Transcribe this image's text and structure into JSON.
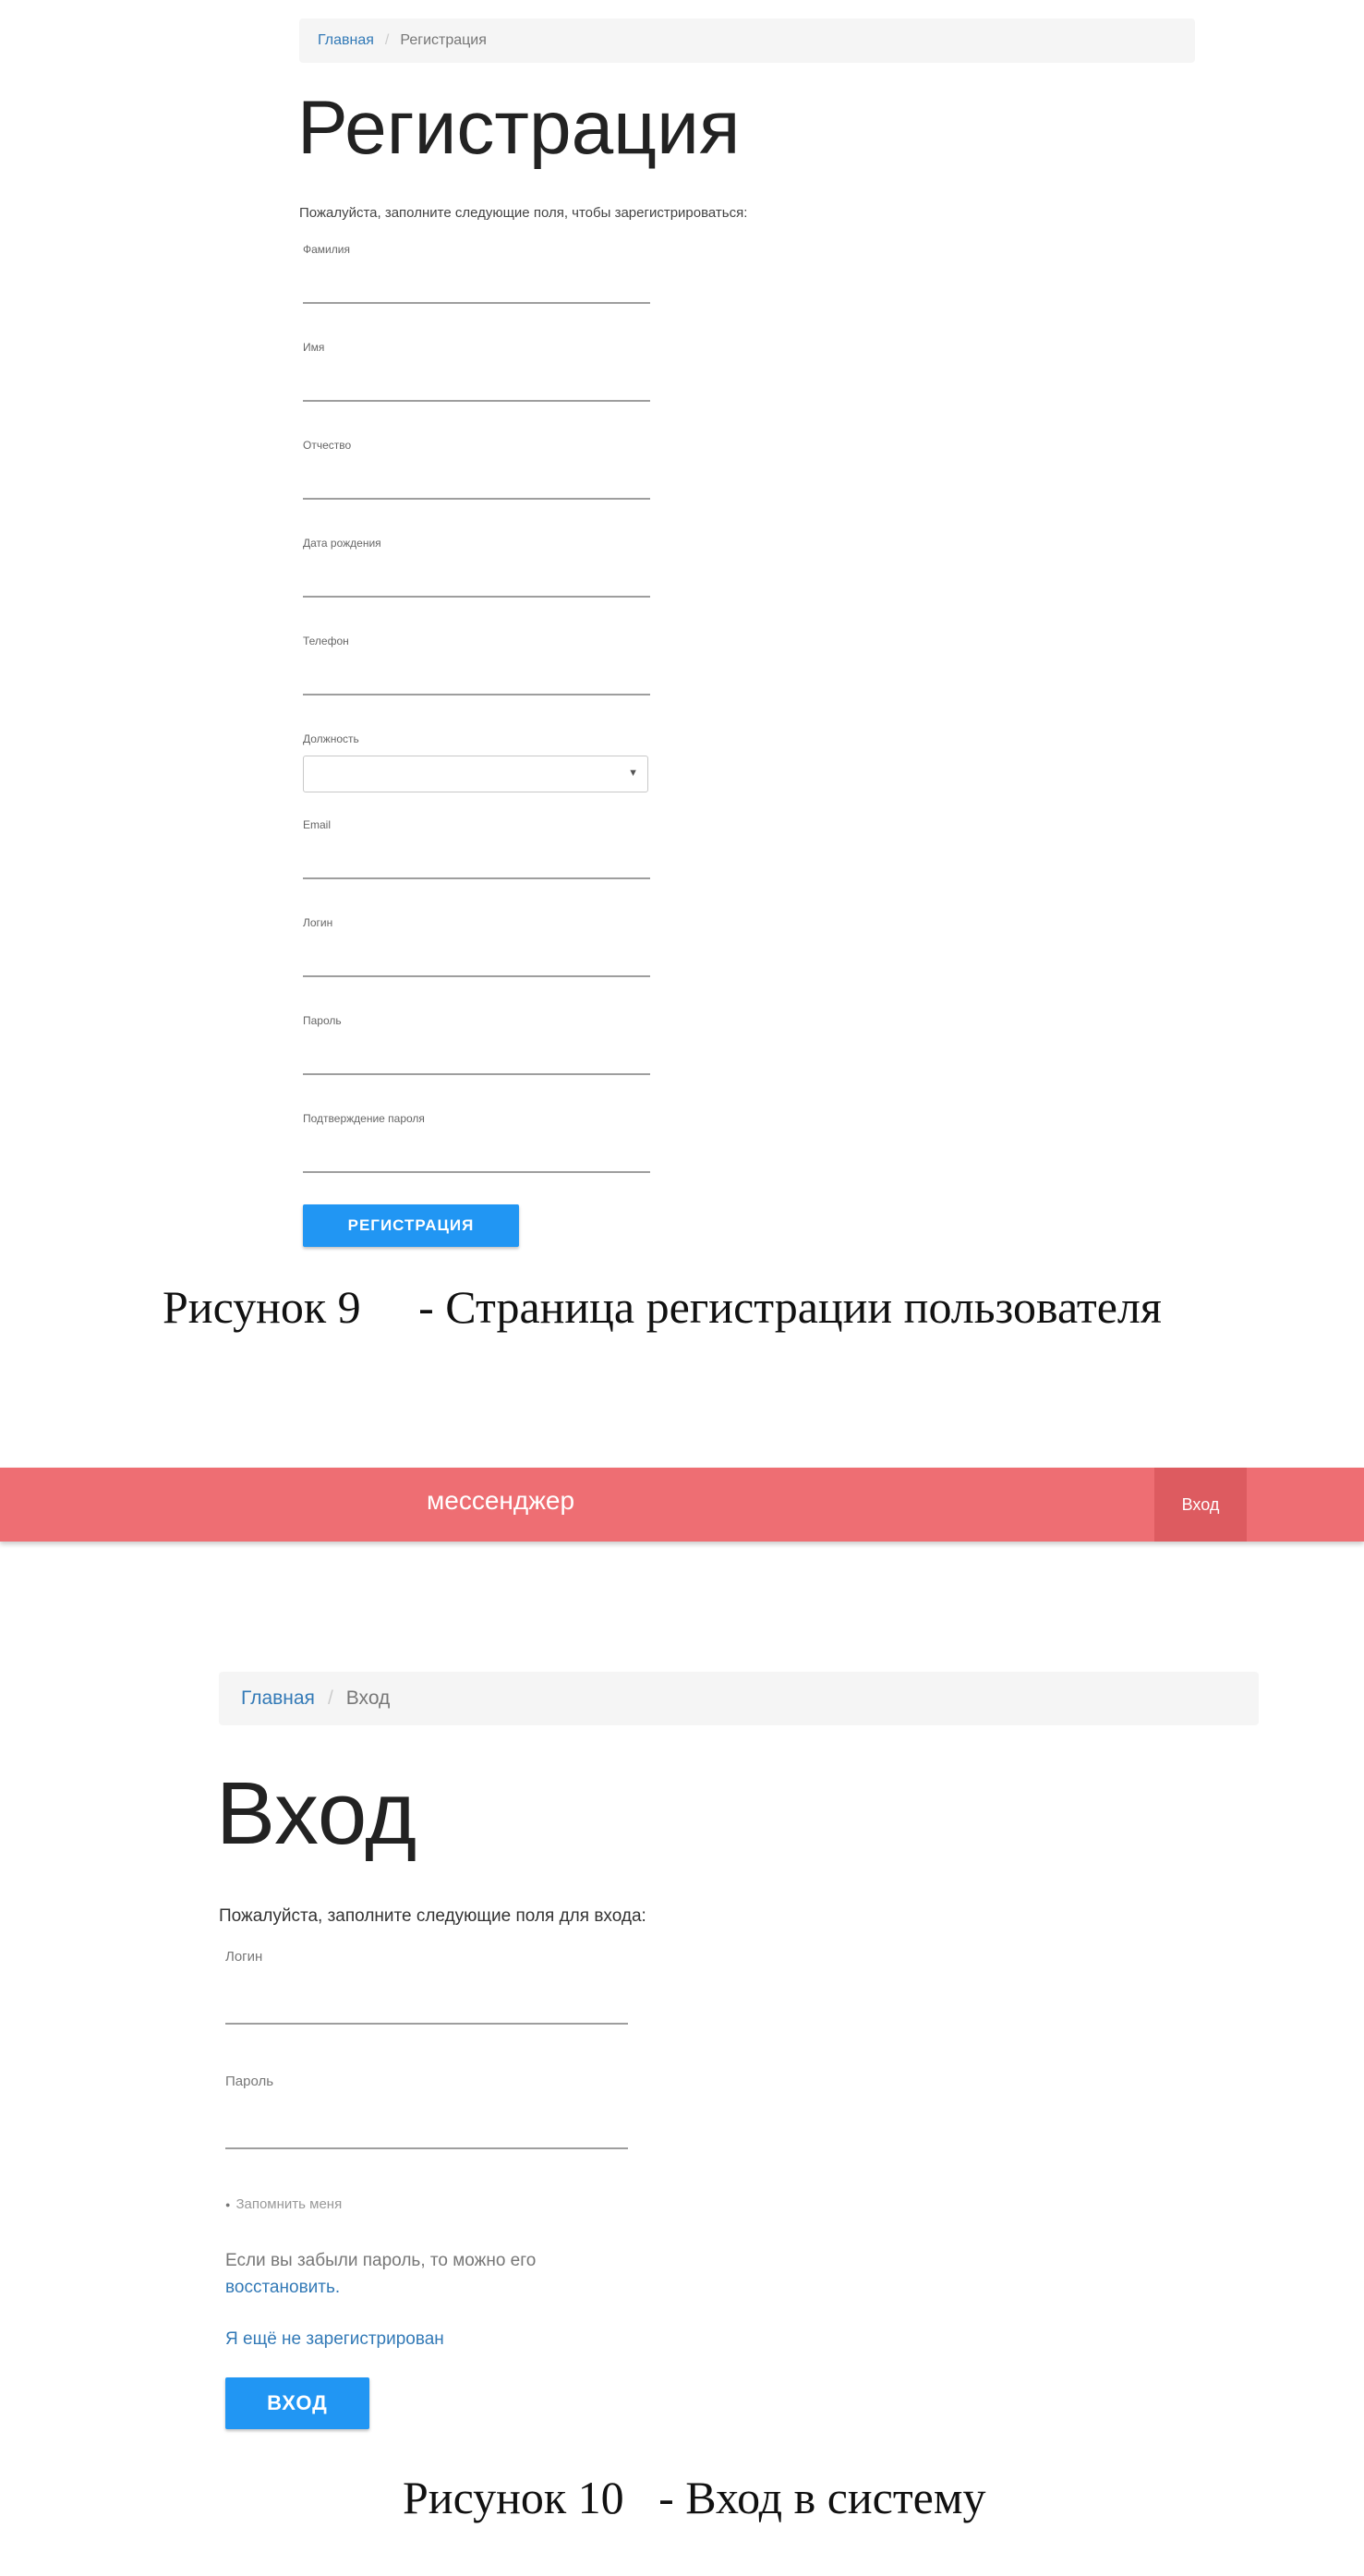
{
  "registration": {
    "breadcrumb": {
      "home": "Главная",
      "separator": "/",
      "current": "Регистрация"
    },
    "title": "Регистрация",
    "intro": "Пожалуйста, заполните следующие поля, чтобы зарегистрироваться:",
    "fields": {
      "last_name": "Фамилия",
      "first_name": "Имя",
      "patronymic": "Отчество",
      "birth_date": "Дата рождения",
      "phone": "Телефон",
      "position": "Должность",
      "email": "Email",
      "login": "Логин",
      "password": "Пароль",
      "password_confirm": "Подтверждение пароля"
    },
    "select_caret": "▼",
    "submit": "РЕГИСТРАЦИЯ"
  },
  "caption9": "Рисунок 9     - Страница регистрации пользователя",
  "navbar": {
    "brand": "мессенджер",
    "login": "Вход",
    "color": "#ee6e73"
  },
  "login": {
    "breadcrumb": {
      "home": "Главная",
      "separator": "/",
      "current": "Вход"
    },
    "title": "Вход",
    "intro": "Пожалуйста, заполните следующие поля для входа:",
    "fields": {
      "login": "Логин",
      "password": "Пароль"
    },
    "remember": "Запомнить меня",
    "remember_mark": "●",
    "forgot_text": "Если вы забыли пароль, то можно его",
    "forgot_link": "восстановить.",
    "not_registered": "Я ещё не зарегистрирован",
    "submit": "ВХОД"
  },
  "caption10": "Рисунок 10   - Вход в систему",
  "accent": "#2196f3"
}
